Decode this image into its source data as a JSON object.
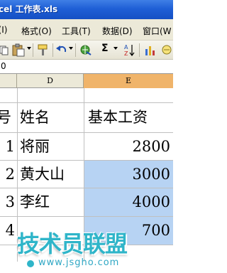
{
  "window": {
    "title": "cel 工作表.xls"
  },
  "menu": {
    "items": [
      {
        "label": "I(I)"
      },
      {
        "label": "格式(O)"
      },
      {
        "label": "工具(T)"
      },
      {
        "label": "数据(D)"
      },
      {
        "label": "窗口(W"
      }
    ]
  },
  "toolbar": {
    "sum_label": "Σ",
    "sort_label": "A↓Z"
  },
  "formula_bar": {
    "cell_ref": "0"
  },
  "columns": [
    "D",
    "E"
  ],
  "table": {
    "headers": {
      "col_c": "号",
      "col_d": "姓名",
      "col_e": "基本工资"
    },
    "rows": [
      {
        "num": "1",
        "name": "将丽",
        "salary": "2800"
      },
      {
        "num": "2",
        "name": "黄大山",
        "salary": "3000"
      },
      {
        "num": "3",
        "name": "李红",
        "salary": "4000"
      },
      {
        "num": "4",
        "name": "",
        "salary": "700"
      }
    ]
  },
  "watermark": {
    "brand": "技术员联盟",
    "url": "www.jsgho.com"
  }
}
